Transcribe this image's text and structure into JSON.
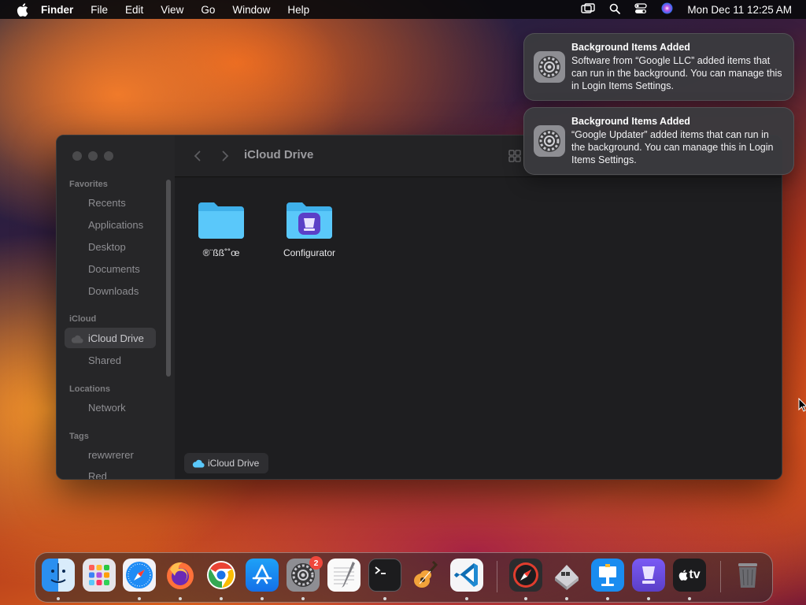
{
  "menubar": {
    "app_name": "Finder",
    "menus": [
      "File",
      "Edit",
      "View",
      "Go",
      "Window",
      "Help"
    ],
    "clock": "Mon Dec 11  12:25 AM"
  },
  "finder": {
    "title": "iCloud Drive",
    "sidebar": {
      "favorites_header": "Favorites",
      "favorites": [
        "Recents",
        "Applications",
        "Desktop",
        "Documents",
        "Downloads"
      ],
      "icloud_header": "iCloud",
      "icloud": [
        "iCloud Drive",
        "Shared"
      ],
      "locations_header": "Locations",
      "locations": [
        "Network"
      ],
      "tags_header": "Tags",
      "tags": [
        "rewwrerer",
        "Red"
      ]
    },
    "files": [
      {
        "name": "®¨ßß˚˚œ",
        "icon": "folder-icon"
      },
      {
        "name": "Configurator",
        "icon": "configurator-folder-icon"
      }
    ],
    "path_bar": "iCloud Drive"
  },
  "notifications": [
    {
      "title": "Background Items Added",
      "body": "Software from “Google LLC” added items that can run in the background. You can manage this in Login Items Settings."
    },
    {
      "title": "Background Items Added",
      "body": "“Google Updater” added items that can run in the background. You can manage this in Login Items Settings."
    }
  ],
  "dock": {
    "apps": [
      "Finder",
      "Launchpad",
      "Safari",
      "Firefox",
      "Chrome",
      "App Store",
      "System Settings",
      "TextEdit",
      "Terminal",
      "GarageBand",
      "Visual Studio Code",
      "Safari Technology Preview",
      "Boot Camp Assistant",
      "Keynote",
      "Apple Configurator",
      "Apple TV",
      "Trash"
    ],
    "settings_badge": "2",
    "tv_label": "tv"
  },
  "colors": {
    "accent": "#3c82f6",
    "folder": "#5ac8fa",
    "badge": "#f0473c"
  }
}
